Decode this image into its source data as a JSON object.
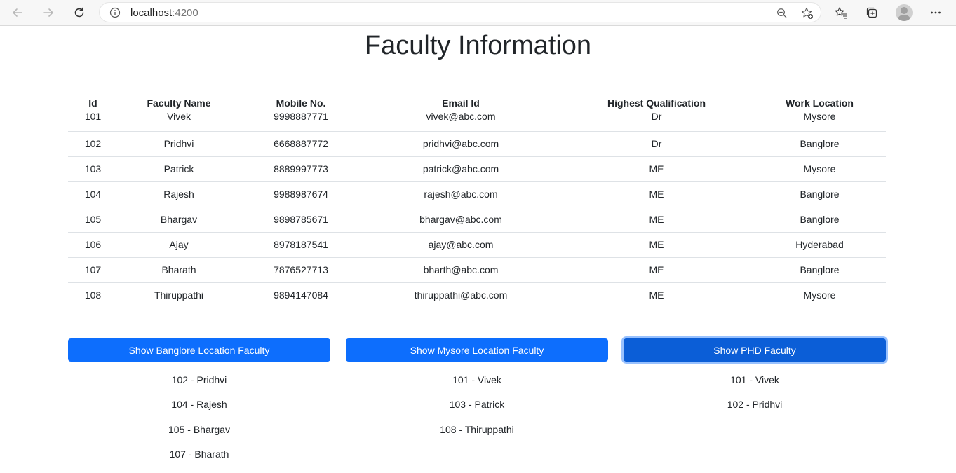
{
  "browser": {
    "url_host": "localhost",
    "url_port": ":4200"
  },
  "page": {
    "title": "Faculty Information"
  },
  "table": {
    "headers": [
      "Id",
      "Faculty Name",
      "Mobile No.",
      "Email Id",
      "Highest Qualification",
      "Work Location"
    ],
    "rows": [
      [
        "101",
        "Vivek",
        "9998887771",
        "vivek@abc.com",
        "Dr",
        "Mysore"
      ],
      [
        "102",
        "Pridhvi",
        "6668887772",
        "pridhvi@abc.com",
        "Dr",
        "Banglore"
      ],
      [
        "103",
        "Patrick",
        "8889997773",
        "patrick@abc.com",
        "ME",
        "Mysore"
      ],
      [
        "104",
        "Rajesh",
        "9988987674",
        "rajesh@abc.com",
        "ME",
        "Banglore"
      ],
      [
        "105",
        "Bhargav",
        "9898785671",
        "bhargav@abc.com",
        "ME",
        "Banglore"
      ],
      [
        "106",
        "Ajay",
        "8978187541",
        "ajay@abc.com",
        "ME",
        "Hyderabad"
      ],
      [
        "107",
        "Bharath",
        "7876527713",
        "bharth@abc.com",
        "ME",
        "Banglore"
      ],
      [
        "108",
        "Thiruppathi",
        "9894147084",
        "thiruppathi@abc.com",
        "ME",
        "Mysore"
      ]
    ]
  },
  "buttons": {
    "banglore": "Show Banglore Location Faculty",
    "mysore": "Show Mysore Location Faculty",
    "phd": "Show PHD Faculty"
  },
  "results": {
    "banglore": [
      "102 - Pridhvi",
      "104 - Rajesh",
      "105 - Bhargav",
      "107 - Bharath"
    ],
    "mysore": [
      "101 - Vivek",
      "103 - Patrick",
      "108 - Thiruppathi"
    ],
    "phd": [
      "101 - Vivek",
      "102 - Pridhvi"
    ]
  },
  "colors": {
    "primary": "#0d6efd",
    "primary_active": "#0b5ed7"
  },
  "icons": [
    "back-icon",
    "forward-icon",
    "refresh-icon",
    "info-icon",
    "zoom-icon",
    "add-favorite-icon",
    "favorites-icon",
    "collections-icon",
    "profile-avatar",
    "more-icon"
  ]
}
